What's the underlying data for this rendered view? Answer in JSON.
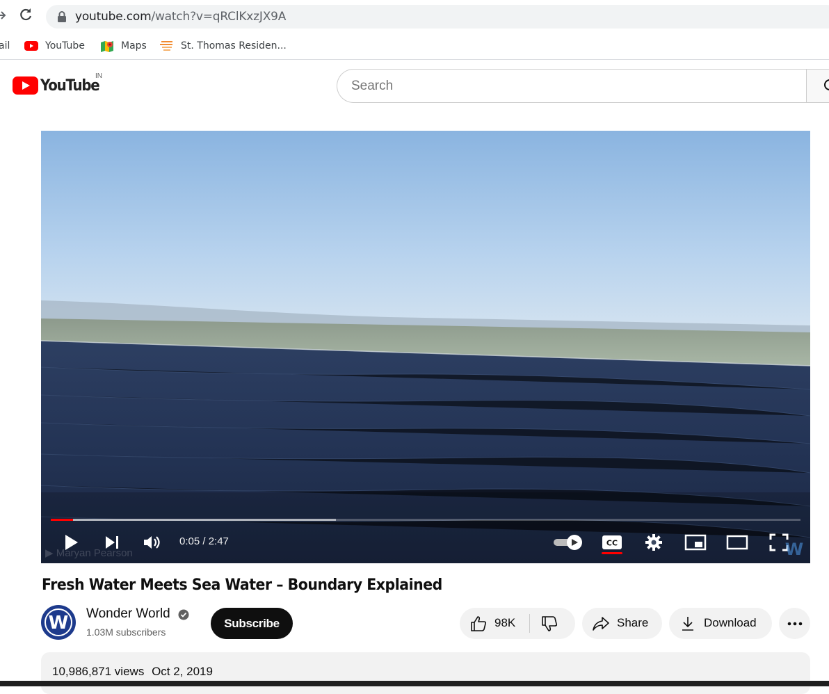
{
  "browser": {
    "url_host": "youtube.com",
    "url_path": "/watch?v=qRClKxzJX9A",
    "bookmarks": [
      {
        "label": "ail",
        "icon": "gmail-icon"
      },
      {
        "label": "YouTube",
        "icon": "youtube-icon"
      },
      {
        "label": "Maps",
        "icon": "maps-icon"
      },
      {
        "label": "St. Thomas Residen...",
        "icon": "site-icon"
      }
    ]
  },
  "masthead": {
    "logo_text": "YouTube",
    "country_code": "IN",
    "search_placeholder": "Search"
  },
  "player": {
    "current_time": "0:05",
    "duration": "2:47",
    "time_display": "0:05 / 2:47",
    "played_fraction": 0.03,
    "buffered_fraction": 0.38,
    "watermark": "Maryan Pearson",
    "autoplay_on": true,
    "captions_on": true,
    "accent": "#ff0000"
  },
  "video": {
    "title": "Fresh Water Meets Sea Water – Boundary Explained",
    "channel_name": "Wonder World",
    "subscribers": "1.03M subscribers",
    "avatar_letter": "W",
    "subscribe_label": "Subscribe",
    "likes": "98K",
    "share_label": "Share",
    "download_label": "Download",
    "views": "10,986,871 views",
    "date": "Oct 2, 2019"
  }
}
